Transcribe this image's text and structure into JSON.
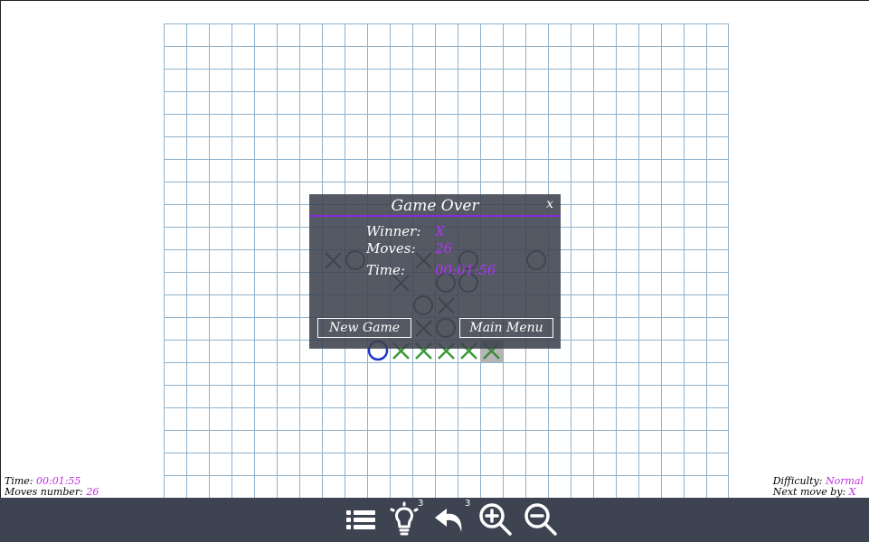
{
  "dialog": {
    "title": "Game Over",
    "close_label": "x",
    "winner_label": "Winner:",
    "winner_value": "X",
    "moves_label": "Moves:",
    "moves_value": "26",
    "time_label": "Time:",
    "time_value": "00:01:56",
    "new_game_label": "New Game",
    "main_menu_label": "Main Menu"
  },
  "status_left": {
    "time_label": "Time:",
    "time_value": "00:01:55",
    "moves_label": "Moves number:",
    "moves_value": "26"
  },
  "status_right": {
    "difficulty_label": "Difficulty:",
    "difficulty_value": "Normal",
    "next_move_label": "Next move by:",
    "next_move_value": "X"
  },
  "toolbar": {
    "hint_count": "3",
    "undo_count": "3",
    "icons": [
      "list-icon",
      "lightbulb-icon",
      "undo-icon",
      "zoom-in-icon",
      "zoom-out-icon"
    ]
  },
  "colors": {
    "accent": "#8a2be2",
    "value_purple": "#b430ff",
    "toolbar_bg": "#3d4351",
    "grid_line": "#8fb2cd",
    "winning_x": "#3a9a3a",
    "last_o": "#1a35c4"
  }
}
